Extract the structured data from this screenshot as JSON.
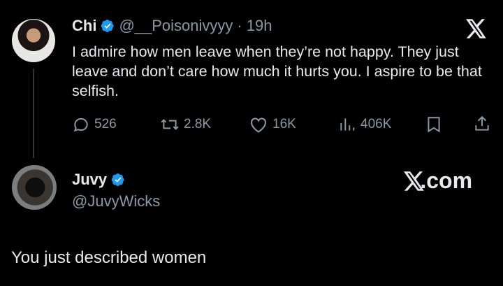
{
  "tweet1": {
    "name": "Chi",
    "handle": "@__Poisonivyyy",
    "sep": "·",
    "time": "19h",
    "text": "I admire how men leave when they’re not happy. They just leave and don’t care how much it hurts you. I aspire to be that selfish.",
    "replies": "526",
    "reposts": "2.8K",
    "likes": "16K",
    "views": "406K"
  },
  "tweet2": {
    "name": "Juvy",
    "handle": "@JuvyWicks",
    "text": "You just described women"
  },
  "brand": {
    "site": "X.com"
  },
  "colors": {
    "background": "#000000",
    "text": "#e7e9ea",
    "secondary": "#8b98a5",
    "verified": "#1d9bf0"
  }
}
